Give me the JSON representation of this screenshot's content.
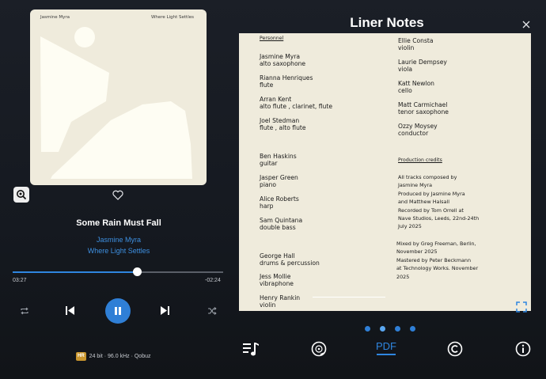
{
  "cover": {
    "artist": "Jasmine Myra",
    "album": "Where Light Settles"
  },
  "track": {
    "title": "Some Rain Must Fall",
    "artist": "Jasmine Myra",
    "album": "Where Light Settles",
    "elapsed": "03:27",
    "remaining": "-02:24",
    "progress": 0.59
  },
  "quality": {
    "badge": "HR",
    "text": "24 bit · 96.0 kHz · Qobuz"
  },
  "notes": {
    "title": "Liner Notes",
    "personnel_heading": "Personnel",
    "left_column": [
      {
        "name": "Jasmine Myra",
        "role": "alto saxophone"
      },
      {
        "name": "Rianna Henriques",
        "role": "flute"
      },
      {
        "name": "Arran Kent",
        "role": "alto flute , clarinet, flute"
      },
      {
        "name": "Joel Stedman",
        "role": "flute , alto flute"
      },
      {
        "name": "Ben Haskins",
        "role": "guitar"
      },
      {
        "name": "Jasper Green",
        "role": "piano"
      },
      {
        "name": "Alice Roberts",
        "role": "harp"
      },
      {
        "name": "Sam Quintana",
        "role": "double bass"
      },
      {
        "name": "George Hall",
        "role": "drums & percussion"
      },
      {
        "name": "Jess Mollie",
        "role": "vibraphone"
      },
      {
        "name": "Henry Rankin",
        "role": "violin"
      }
    ],
    "right_column": [
      {
        "name": "Ellie Consta",
        "role": "violin"
      },
      {
        "name": "Laurie Dempsey",
        "role": "viola"
      },
      {
        "name": "Katt Newlon",
        "role": "cello"
      },
      {
        "name": "Matt Carmichael",
        "role": "tenor saxophone"
      },
      {
        "name": "Ozzy Moysey",
        "role": "conductor"
      }
    ],
    "credits_heading": "Production credits",
    "credits_1": [
      "All tracks composed by",
      "Jasmine Myra",
      "Produced by Jasmine Myra",
      "and Matthew Halsall",
      "Recorded by Tom Orrell at",
      "Nave Studios, Leeds, 22nd-24th",
      "July 2025"
    ],
    "credits_2": [
      "Mixed by Greg Freeman, Berlin,",
      "November 2025",
      "Mastered by Peter Beckmann",
      "at Technology Works. November",
      "2025"
    ]
  },
  "tabs": {
    "pdf_label": "PDF"
  },
  "colors": {
    "accent": "#2f86e0",
    "background": "#171b22",
    "paper": "#efebdc"
  },
  "icons": [
    "zoom-icon",
    "heart-icon",
    "repeat-icon",
    "previous-icon",
    "pause-icon",
    "next-icon",
    "shuffle-icon",
    "close-icon",
    "expand-icon",
    "music-list-icon",
    "disc-icon",
    "copyright-icon",
    "info-icon"
  ]
}
